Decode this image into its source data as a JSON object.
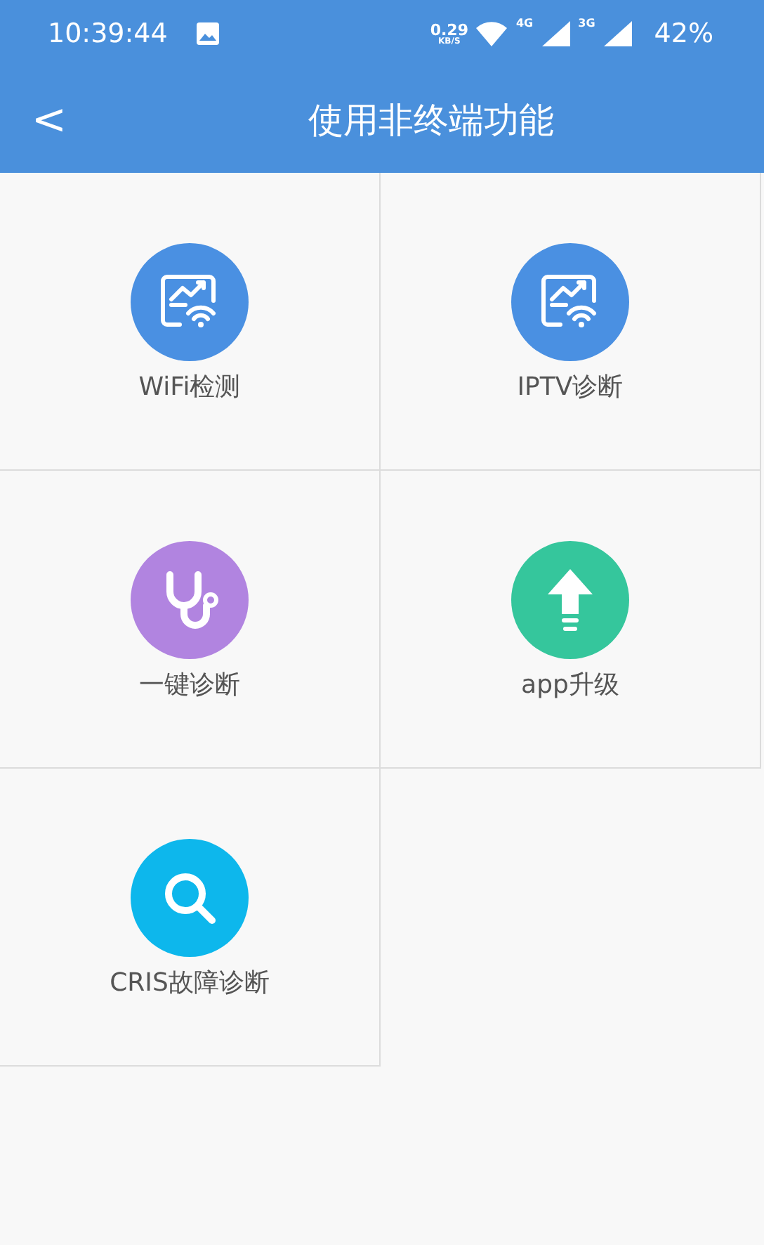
{
  "status_bar": {
    "time": "10:39:44",
    "speed": "0.29",
    "speed_unit": "KB/S",
    "network_1": "4G",
    "network_2": "3G",
    "battery": "42%"
  },
  "header": {
    "back": "<",
    "title": "使用非终端功能"
  },
  "tiles": [
    {
      "label": "WiFi检测",
      "kind": "wifi-chart",
      "color": "#4a90e2"
    },
    {
      "label": "IPTV诊断",
      "kind": "wifi-chart",
      "color": "#4a90e2"
    },
    {
      "label": "一键诊断",
      "kind": "stethoscope",
      "color": "#b184e0"
    },
    {
      "label": "app升级",
      "kind": "upload",
      "color": "#35c69c"
    },
    {
      "label": "CRIS故障诊断",
      "kind": "search",
      "color": "#0db7ec"
    }
  ]
}
